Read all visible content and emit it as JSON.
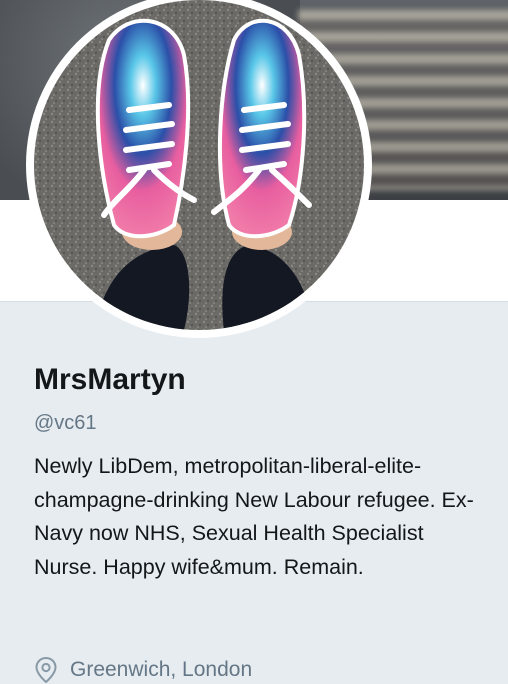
{
  "profile": {
    "display_name": "MrsMartyn",
    "handle": "@vc61",
    "bio": "Newly LibDem, metropolitan-liberal-elite-champagne-drinking New Labour refugee. Ex-Navy now NHS, Sexual Health Specialist Nurse. Happy wife&mum. Remain.",
    "location": "Greenwich, London"
  },
  "icons": {
    "location": "map-pin-icon"
  },
  "colors": {
    "text_primary": "#14171a",
    "text_secondary": "#657786",
    "background": "#e6ecf0"
  }
}
